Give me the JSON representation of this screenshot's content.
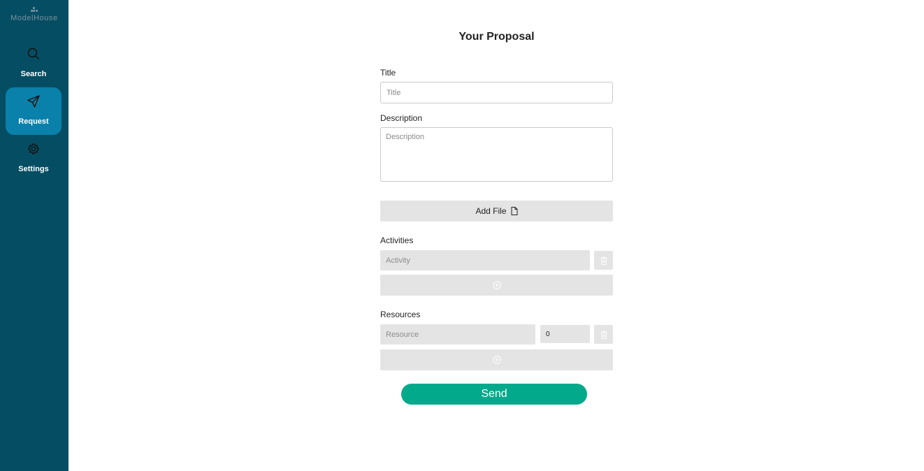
{
  "sidebar": {
    "brand": "ModelHouse",
    "items": [
      {
        "label": "Search",
        "icon": "search-icon",
        "active": false
      },
      {
        "label": "Request",
        "icon": "send-icon",
        "active": true
      },
      {
        "label": "Settings",
        "icon": "gear-icon",
        "active": false
      }
    ]
  },
  "form": {
    "title": "Your Proposal",
    "title_field": {
      "label": "Title",
      "placeholder": "Title",
      "value": ""
    },
    "description_field": {
      "label": "Description",
      "placeholder": "Description",
      "value": ""
    },
    "add_file_label": "Add File",
    "activities": {
      "label": "Activities",
      "rows": [
        {
          "placeholder": "Activity",
          "value": ""
        }
      ]
    },
    "resources": {
      "label": "Resources",
      "rows": [
        {
          "placeholder": "Resource",
          "value": "",
          "quantity": "0"
        }
      ]
    },
    "send_label": "Send"
  },
  "colors": {
    "sidebar_bg": "#054d62",
    "nav_active": "#0981ab",
    "send_button": "#03a98b",
    "field_grey": "#e4e4e4"
  }
}
